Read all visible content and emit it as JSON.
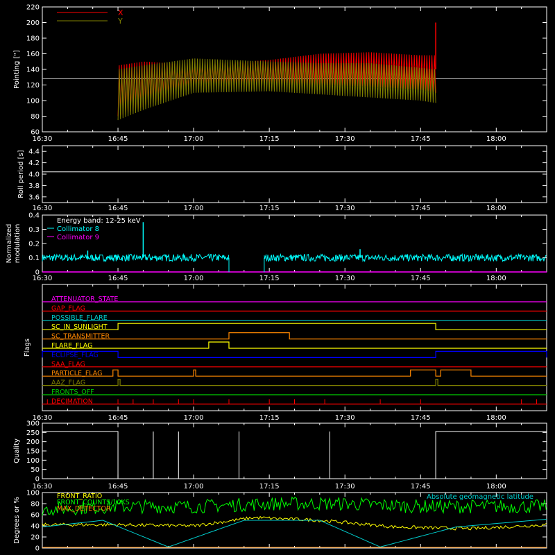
{
  "colors": {
    "background": "#000000",
    "axes": "#ffffff",
    "x_series": "#ff0000",
    "y_series": "#808000",
    "collimator8": "#00ffff",
    "collimator9": "#ff00ff",
    "geomag": "#00cccc",
    "front_ratio": "#ffff00",
    "front_counts": "#00ff00"
  },
  "time_ticks": [
    "16:30",
    "16:45",
    "17:00",
    "17:15",
    "17:30",
    "17:45",
    "18:00"
  ],
  "chart_data": [
    {
      "type": "area",
      "ylabel": "Pointing [\"]",
      "ylim": [
        60,
        220
      ],
      "yticks": [
        "60",
        "80",
        "100",
        "120",
        "140",
        "160",
        "180",
        "200",
        "220"
      ],
      "reference_line": 128,
      "legend": [
        "X",
        "Y"
      ],
      "series": [
        {
          "name": "X",
          "x": [
            "16:45",
            "16:50",
            "17:00",
            "17:15",
            "17:25",
            "17:35",
            "17:45",
            "17:48"
          ],
          "low": [
            80,
            92,
            118,
            120,
            120,
            118,
            114,
            110
          ],
          "high": [
            145,
            150,
            146,
            152,
            160,
            162,
            158,
            158
          ]
        },
        {
          "name": "Y",
          "x": [
            "16:45",
            "16:50",
            "17:00",
            "17:15",
            "17:25",
            "17:35",
            "17:45",
            "17:48"
          ],
          "low": [
            75,
            88,
            110,
            112,
            108,
            104,
            100,
            97
          ],
          "high": [
            140,
            145,
            154,
            150,
            148,
            148,
            142,
            140
          ]
        }
      ]
    },
    {
      "type": "line",
      "ylabel": "Roll period [s]",
      "ylim": [
        3.5,
        4.5
      ],
      "yticks": [
        "3.6",
        "3.8",
        "4.0",
        "4.2",
        "4.4"
      ],
      "series": [
        {
          "x": [
            "16:30",
            "18:10"
          ],
          "values": [
            4.04,
            4.04
          ]
        }
      ]
    },
    {
      "type": "line",
      "ylabel": "Normalized modulation",
      "ylim": [
        0,
        0.4
      ],
      "yticks": [
        "0",
        "0.1",
        "0.2",
        "0.3",
        "0.4"
      ],
      "annotation": "Energy band: 12-25 keV",
      "legend": [
        "Collimator 8",
        "Collimator 9"
      ],
      "series": [
        {
          "name": "Collimator 8",
          "mean": 0.1,
          "segments": [
            [
              "16:30",
              "17:07"
            ],
            [
              "17:14",
              "18:10"
            ]
          ],
          "spikes": [
            [
              "16:50",
              0.35
            ],
            [
              "17:33",
              0.16
            ],
            [
              "16:39",
              0.15
            ]
          ]
        },
        {
          "name": "Collimator 9",
          "values": [
            0,
            0
          ]
        }
      ]
    },
    {
      "type": "line",
      "ylabel": "Flags",
      "flags": [
        {
          "label": "ATTENUATOR_STATE",
          "color": "#ff00ff",
          "segments": []
        },
        {
          "label": "GAP_FLAG",
          "color": "#ff0000",
          "segments": []
        },
        {
          "label": "POSSIBLE_FLARE",
          "color": "#00cccc",
          "segments": []
        },
        {
          "label": "SC_IN_SUNLIGHT",
          "color": "#ffff00",
          "segments": [
            [
              "16:45",
              "17:48"
            ]
          ]
        },
        {
          "label": "SC_TRANSMITTER",
          "color": "#ff8800",
          "segments": [
            [
              "17:07",
              "17:19"
            ]
          ]
        },
        {
          "label": "FLARE_FLAG",
          "color": "#ffff00",
          "segments": [
            [
              "17:03",
              "17:07"
            ]
          ]
        },
        {
          "label": "ECLIPSE_FLAG",
          "color": "#0000ff",
          "segments": [
            [
              "16:30",
              "16:45"
            ],
            [
              "17:48",
              "18:10"
            ]
          ]
        },
        {
          "label": "SAA_FLAG",
          "color": "#ff0000",
          "segments": []
        },
        {
          "label": "PARTICLE_FLAG",
          "color": "#ff8800",
          "segments": [
            [
              "16:44",
              "16:45"
            ],
            [
              "17:00",
              "17:00"
            ],
            [
              "17:43",
              "17:48"
            ],
            [
              "17:49",
              "17:55"
            ]
          ]
        },
        {
          "label": "AAZ_FLAG",
          "color": "#808000",
          "segments": [
            [
              "16:45",
              "16:45"
            ],
            [
              "17:48",
              "17:48"
            ]
          ]
        },
        {
          "label": "FRONTS_OFF",
          "color": "#00cc00",
          "segments": []
        },
        {
          "label": "DECIMATION",
          "color": "#ff0000",
          "segments": []
        }
      ]
    },
    {
      "type": "line",
      "ylabel": "Quality",
      "ylim": [
        0,
        300
      ],
      "yticks": [
        "0",
        "50",
        "100",
        "150",
        "200",
        "250",
        "300"
      ],
      "series": [
        {
          "level": 255,
          "segments": [
            [
              "16:30",
              "16:45"
            ],
            [
              "17:48",
              "18:10"
            ]
          ],
          "spikes": [
            "16:57",
            "17:09",
            "17:27",
            "16:52"
          ]
        }
      ]
    },
    {
      "type": "line",
      "ylabel": "Degrees or %",
      "ylim": [
        0,
        100
      ],
      "yticks": [
        "0",
        "20",
        "40",
        "60",
        "80",
        "100"
      ],
      "legend": [
        "FRONT_RATIO",
        "FRONT_COUNTS/10KS",
        "MAX_DETECTOR"
      ],
      "annotation": "Absolute geomagnetic latitude",
      "series": [
        {
          "name": "Absolute geomagnetic latitude",
          "x": [
            "16:30",
            "16:42",
            "16:55",
            "17:10",
            "17:25",
            "17:37",
            "17:52",
            "18:10"
          ],
          "values": [
            38,
            50,
            2,
            50,
            50,
            2,
            38,
            52
          ]
        },
        {
          "name": "FRONT_RATIO",
          "x": [
            "16:30",
            "16:45",
            "17:00",
            "17:12",
            "17:25",
            "17:40",
            "17:55",
            "18:10"
          ],
          "values": [
            42,
            42,
            40,
            55,
            50,
            38,
            35,
            42
          ]
        },
        {
          "name": "FRONT_COUNTS/10KS",
          "x": [
            "16:30",
            "16:45",
            "17:00",
            "17:15",
            "17:30",
            "17:45",
            "18:00",
            "18:10"
          ],
          "values": [
            70,
            75,
            75,
            80,
            80,
            75,
            75,
            75
          ]
        }
      ]
    }
  ]
}
